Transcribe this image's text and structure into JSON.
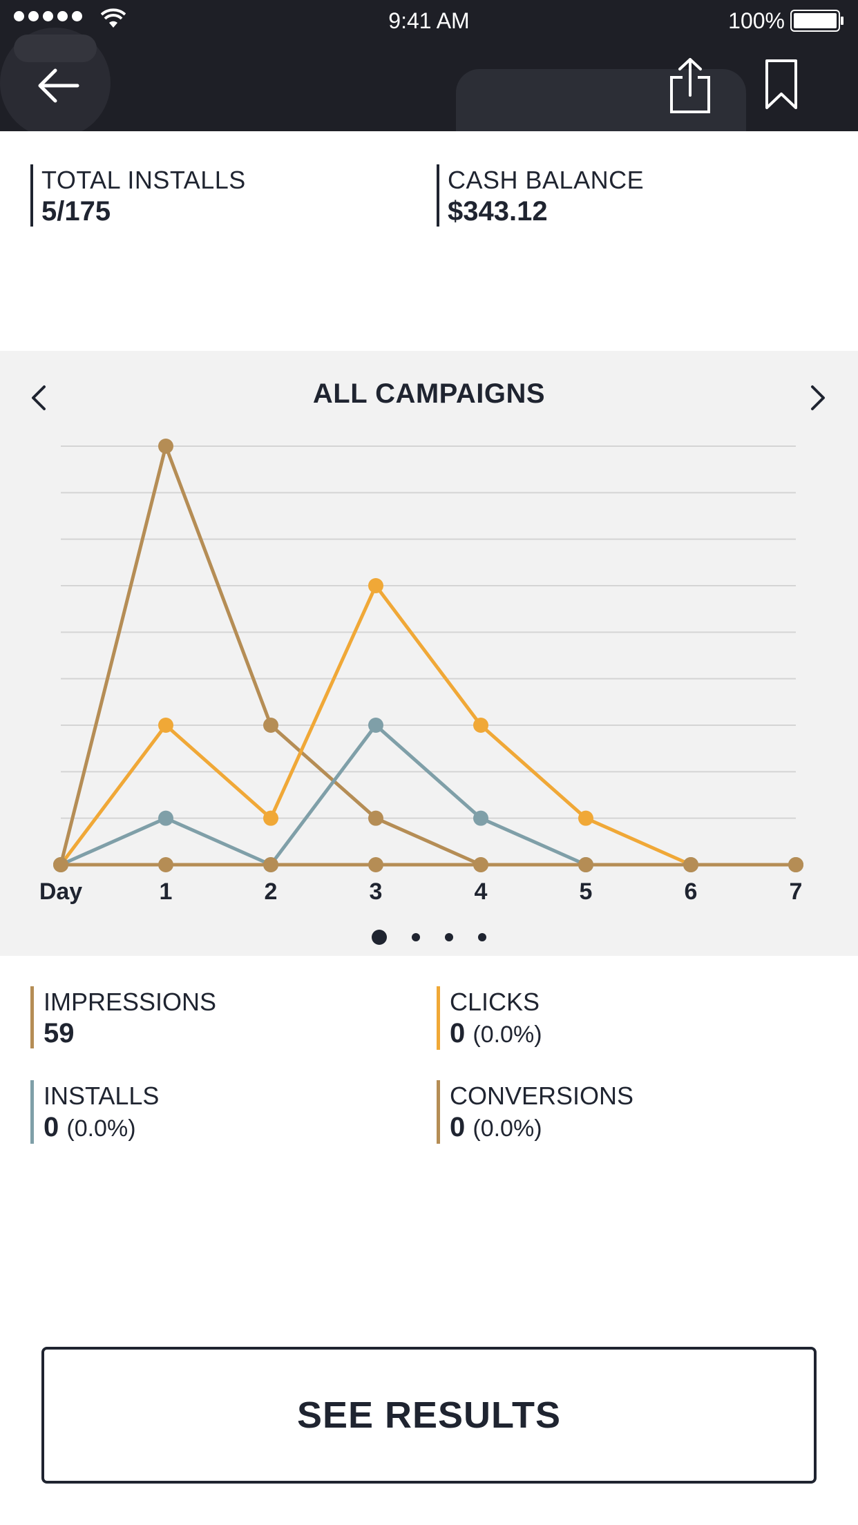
{
  "status_bar": {
    "time": "9:41 AM",
    "battery": "100%"
  },
  "header": {
    "back_icon": "arrow-left-icon",
    "share_icon": "share-icon",
    "bookmark_icon": "bookmark-icon"
  },
  "summary": {
    "total_installs": {
      "label": "TOTAL INSTALLS",
      "value": "5/175"
    },
    "cash_balance": {
      "label": "CASH BALANCE",
      "value": "$343.12"
    }
  },
  "chart_panel": {
    "title": "ALL CAMPAIGNS",
    "prev_icon": "chevron-left-icon",
    "next_icon": "chevron-right-icon",
    "page_count": 4,
    "active_page": 0
  },
  "chart_data": {
    "type": "line",
    "x": [
      "Day",
      "1",
      "2",
      "3",
      "4",
      "5",
      "6",
      "7"
    ],
    "ylim": [
      0,
      9
    ],
    "grid": true,
    "series": [
      {
        "key": "impressions",
        "color": "#b58d55",
        "values": [
          0,
          9,
          3,
          1,
          0,
          0,
          0,
          0
        ]
      },
      {
        "key": "clicks",
        "color": "#f0a837",
        "values": [
          0,
          3,
          1,
          6,
          3,
          1,
          0,
          0
        ]
      },
      {
        "key": "installs",
        "color": "#7f9fa8",
        "values": [
          0,
          1,
          0,
          3,
          1,
          0,
          0,
          0
        ]
      },
      {
        "key": "conversions",
        "color": "#b58d55",
        "values": [
          0,
          0,
          0,
          0,
          0,
          0,
          0,
          0
        ]
      }
    ]
  },
  "metrics": {
    "impressions": {
      "label": "IMPRESSIONS",
      "value": "59",
      "pct": "",
      "color": "#b58d55"
    },
    "clicks": {
      "label": "CLICKS",
      "value": "0",
      "pct": "(0.0%)",
      "color": "#f0a837"
    },
    "installs": {
      "label": "INSTALLS",
      "value": "0",
      "pct": "(0.0%)",
      "color": "#7f9fa8"
    },
    "conversions": {
      "label": "CONVERSIONS",
      "value": "0",
      "pct": "(0.0%)",
      "color": "#b58d55"
    }
  },
  "see_results_label": "SEE RESULTS"
}
